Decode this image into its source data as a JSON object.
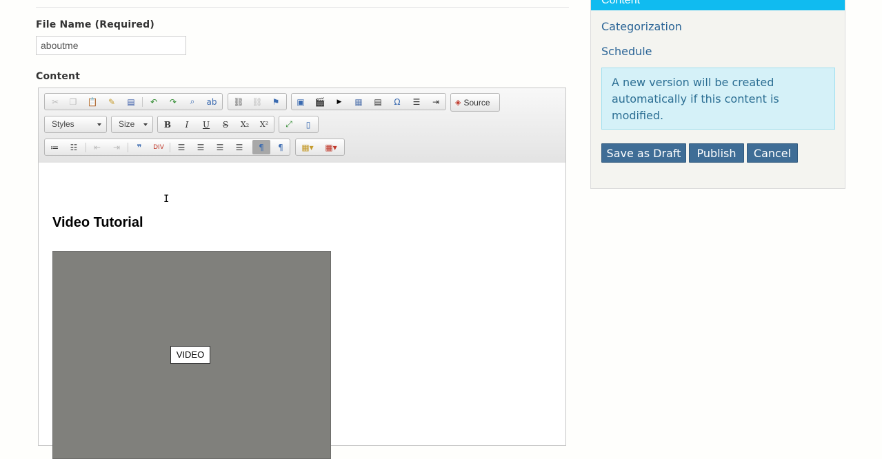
{
  "form": {
    "file_name_label": "File Name (Required)",
    "file_name_value": "aboutme",
    "content_label": "Content"
  },
  "editor": {
    "toolbar": {
      "styles_label": "Styles",
      "size_label": "Size",
      "source_label": "Source",
      "bold": "B",
      "italic": "I",
      "underline": "U",
      "strike": "S",
      "subscript": "X₂",
      "superscript": "X²"
    },
    "heading": "Video Tutorial",
    "video_label": "VIDEO"
  },
  "sidebar": {
    "active_tab": "Content",
    "links": [
      "Categorization",
      "Schedule"
    ],
    "notice": "A new version will be created automatically if this content is modified.",
    "buttons": [
      "Save as Draft",
      "Publish",
      "Cancel"
    ]
  },
  "colors": {
    "accent": "#10bbf0",
    "button": "#3f6d96",
    "notice_bg": "#d5f1f8"
  }
}
